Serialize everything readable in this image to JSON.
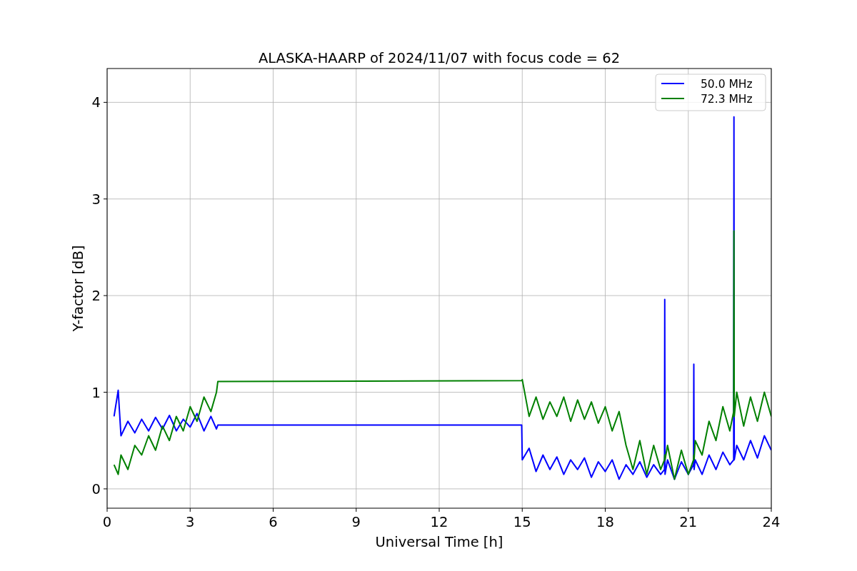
{
  "figure": {
    "chart_data": {
      "type": "line",
      "title": "ALASKA-HAARP of 2024/11/07 with focus code = 62",
      "xlabel": "Universal Time [h]",
      "ylabel": "Y-factor [dB]",
      "x": [
        0.25,
        0.4,
        0.5,
        0.75,
        1,
        1.25,
        1.5,
        1.75,
        2,
        2.25,
        2.5,
        2.75,
        3,
        3.25,
        3.5,
        3.75,
        3.95,
        4,
        14.98,
        15,
        15.25,
        15.5,
        15.75,
        16,
        16.25,
        16.5,
        16.75,
        17,
        17.25,
        17.5,
        17.75,
        18,
        18.25,
        18.5,
        18.75,
        19,
        19.25,
        19.5,
        19.75,
        20,
        20.14,
        20.15,
        20.16,
        20.25,
        20.5,
        20.75,
        21,
        21.19,
        21.2,
        21.21,
        21.25,
        21.5,
        21.75,
        22,
        22.25,
        22.5,
        22.64,
        22.65,
        22.66,
        22.75,
        23,
        23.25,
        23.5,
        23.75,
        24
      ],
      "series": [
        {
          "name": "50.0 MHz",
          "color": "#0000ff",
          "values": [
            0.75,
            1.02,
            0.55,
            0.7,
            0.58,
            0.72,
            0.6,
            0.74,
            0.62,
            0.76,
            0.6,
            0.72,
            0.64,
            0.78,
            0.6,
            0.75,
            0.62,
            0.66,
            0.66,
            0.3,
            0.42,
            0.18,
            0.35,
            0.2,
            0.33,
            0.15,
            0.3,
            0.2,
            0.32,
            0.12,
            0.28,
            0.18,
            0.3,
            0.1,
            0.25,
            0.15,
            0.28,
            0.12,
            0.25,
            0.15,
            0.2,
            1.96,
            0.15,
            0.3,
            0.1,
            0.28,
            0.15,
            0.25,
            1.29,
            0.2,
            0.3,
            0.15,
            0.35,
            0.2,
            0.38,
            0.25,
            0.3,
            3.85,
            0.3,
            0.45,
            0.3,
            0.5,
            0.32,
            0.55,
            0.4
          ]
        },
        {
          "name": "72.3 MHz",
          "color": "#008000",
          "values": [
            0.25,
            0.15,
            0.35,
            0.2,
            0.45,
            0.35,
            0.55,
            0.4,
            0.65,
            0.5,
            0.75,
            0.6,
            0.85,
            0.7,
            0.95,
            0.8,
            1.0,
            1.11,
            1.12,
            1.13,
            0.75,
            0.95,
            0.72,
            0.9,
            0.75,
            0.95,
            0.7,
            0.92,
            0.72,
            0.9,
            0.68,
            0.85,
            0.6,
            0.8,
            0.45,
            0.2,
            0.5,
            0.15,
            0.45,
            0.2,
            0.3,
            0.35,
            0.3,
            0.45,
            0.1,
            0.4,
            0.15,
            0.3,
            0.35,
            0.3,
            0.5,
            0.35,
            0.7,
            0.5,
            0.85,
            0.6,
            0.8,
            2.67,
            0.75,
            1.0,
            0.65,
            0.95,
            0.7,
            1.0,
            0.75
          ]
        }
      ],
      "xlim": [
        0,
        24
      ],
      "ylim": [
        -0.2,
        4.35
      ],
      "xticks": [
        0,
        3,
        6,
        9,
        12,
        15,
        18,
        21,
        24
      ],
      "yticks": [
        0,
        1,
        2,
        3,
        4
      ],
      "grid": true,
      "legend": true
    }
  }
}
